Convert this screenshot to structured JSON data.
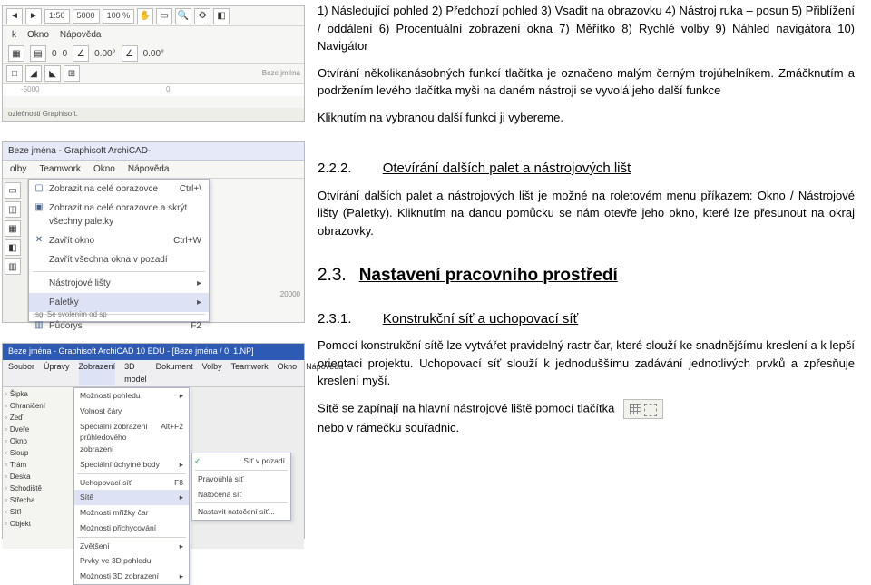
{
  "toolbar_list": "1) Následující pohled 2) Předchozí pohled 3) Vsadit na obrazovku 4) Nástroj ruka – posun 5) Přiblížení / oddálení 6) Procentuální zobrazení okna 7) Měřítko 8) Rychlé volby 9) Náhled navigátora 10) Navigátor",
  "para_open_fns": "Otvírání několikanásobných funkcí tlačítka je označeno malým černým trojúhelníkem. Zmáčknutím a podržením levého tlačítka myši na daném nástroji se vyvolá jeho další funkce",
  "para_click_select": "Kliknutím na vybranou další funkci ji vybereme.",
  "sec222_num": "2.2.2.",
  "sec222_title": "Otevírání dalších palet a nástrojových lišt",
  "para_palettes": "Otvírání dalších palet a nástrojových lišt je možné na roletovém menu příkazem: Okno / Nástrojové lišty (Paletky). Kliknutím na danou pomůcku se nám otevře jeho okno, které lze přesunout na okraj obrazovky.",
  "sec23_num": "2.3.",
  "sec23_title": "Nastavení pracovního prostředí",
  "sec231_num": "2.3.1.",
  "sec231_title": "Konstrukční síť a uchopovací síť",
  "para_grid": "Pomocí konstrukční sítě lze vytvářet pravidelný rastr čar, které slouží ke snadnějšímu kreslení a k lepší orientaci projektu. Uchopovací síť slouží k jednoduššímu zadávání jednotlivých prvků a zpřesňuje kreslení myší.",
  "para_grid_toggle": "Sítě se zapínají na hlavní nástrojové liště pomocí tlačítka",
  "para_grid_toggle2": "nebo v rámečku souřadnic.",
  "shot1": {
    "scale": "1:50",
    "width": "5000",
    "percent": "100 %",
    "zero1": "0",
    "zero2": "0",
    "deg1": "0.00°",
    "deg2": "0.00°",
    "menu_k": "k",
    "menu_okno": "Okno",
    "menu_napoveda": "Nápověda",
    "ruler_m5000": "-5000",
    "ruler_0": "0",
    "status": "ozlečnosti Graphisoft."
  },
  "shot2": {
    "titlebar": "Beze jména - Graphisoft ArchiCAD-",
    "tab1": "olby",
    "tab2": "Teamwork",
    "tab3": "Okno",
    "tab4": "Nápověda",
    "m1": "Zobrazit na celé obrazovce",
    "m1_sc": "Ctrl+\\",
    "m2": "Zobrazit na celé obrazovce a skrýt všechny paletky",
    "m3": "Zavřít okno",
    "m3_sc": "Ctrl+W",
    "m4": "Zavřít všechna okna v pozadí",
    "m5": "Nástrojové lišty",
    "m6": "Paletky",
    "m7": "Půdorys",
    "m7_sc": "F2",
    "footer": "sg. Se svolením od sp",
    "ruler": "20000"
  },
  "shot3": {
    "titlebar": "Beze jména - Graphisoft ArchiCAD 10 EDU - [Beze jména / 0. 1.NP]",
    "menu": [
      "Soubor",
      "Úpravy",
      "Zobrazení",
      "3D model",
      "Dokument",
      "Volby",
      "Teamwork",
      "Okno",
      "Nápověda"
    ],
    "left": [
      "Šipka",
      "Ohraničení",
      "Zeď",
      "Dveře",
      "Okno",
      "Sloup",
      "Trám",
      "Deska",
      "Schodiště",
      "Střecha",
      "Síťl",
      "Objekt"
    ],
    "dd": [
      {
        "l": "Možnosti pohledu",
        "r": "▸"
      },
      {
        "l": "Volnost čáry",
        "r": ""
      },
      {
        "l": "Speciální zobrazení průhledového zobrazení",
        "r": "Alt+F2"
      },
      {
        "l": "Speciální úchytné body",
        "r": "▸"
      },
      {
        "l": "Uchopovací síť",
        "r": "F8"
      },
      {
        "l": "Sítě",
        "r": "▸"
      },
      {
        "l": "Možnosti mřížky čar",
        "r": ""
      },
      {
        "l": "Možnosti přichycování",
        "r": ""
      },
      {
        "l": "Zvětšení",
        "r": "▸"
      },
      {
        "l": "Prvky ve 3D pohledu",
        "r": ""
      },
      {
        "l": "Možnosti 3D zobrazení",
        "r": "▸"
      }
    ],
    "sub": [
      {
        "l": "Síť v pozadí",
        "r": ""
      },
      {
        "l": "Pravoúhlá síť",
        "r": ""
      },
      {
        "l": "Natočená síť",
        "r": ""
      },
      {
        "l": "Nastavit natočení síť...",
        "r": ""
      }
    ]
  }
}
